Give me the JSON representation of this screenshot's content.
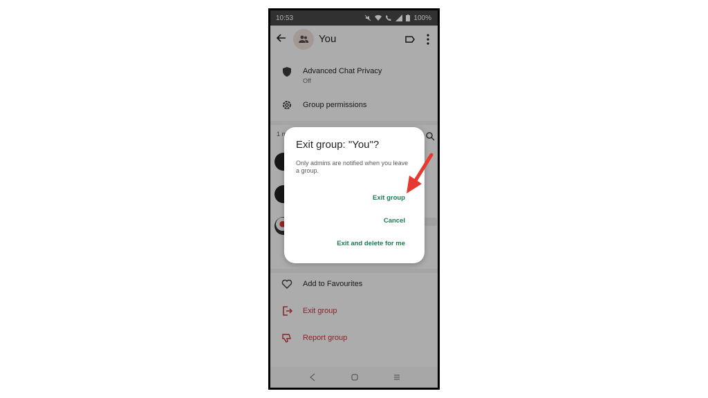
{
  "status_bar": {
    "time": "10:53",
    "battery": "100%"
  },
  "header": {
    "title": "You",
    "back_icon": "arrow-left-icon",
    "avatar_icon": "group-icon"
  },
  "settings": [
    {
      "icon": "shield-icon",
      "label": "Advanced Chat Privacy",
      "sub": "Off"
    },
    {
      "icon": "gear-icon",
      "label": "Group permissions"
    }
  ],
  "members": {
    "count_label": "1 m"
  },
  "dialog": {
    "title": "Exit group: \"You\"?",
    "body": "Only admins are notified when you leave a group.",
    "buttons": {
      "exit": "Exit group",
      "cancel": "Cancel",
      "exit_delete": "Exit and delete for me"
    },
    "button_color": "#1c7a4f"
  },
  "actions": [
    {
      "icon": "heart-icon",
      "label": "Add to Favourites"
    },
    {
      "icon": "exit-icon",
      "label": "Exit group",
      "color": "#c7303c"
    },
    {
      "icon": "thumbs-down-icon",
      "label": "Report group",
      "color": "#c7303c"
    }
  ],
  "annotation": {
    "arrow_color": "#e8382f"
  }
}
